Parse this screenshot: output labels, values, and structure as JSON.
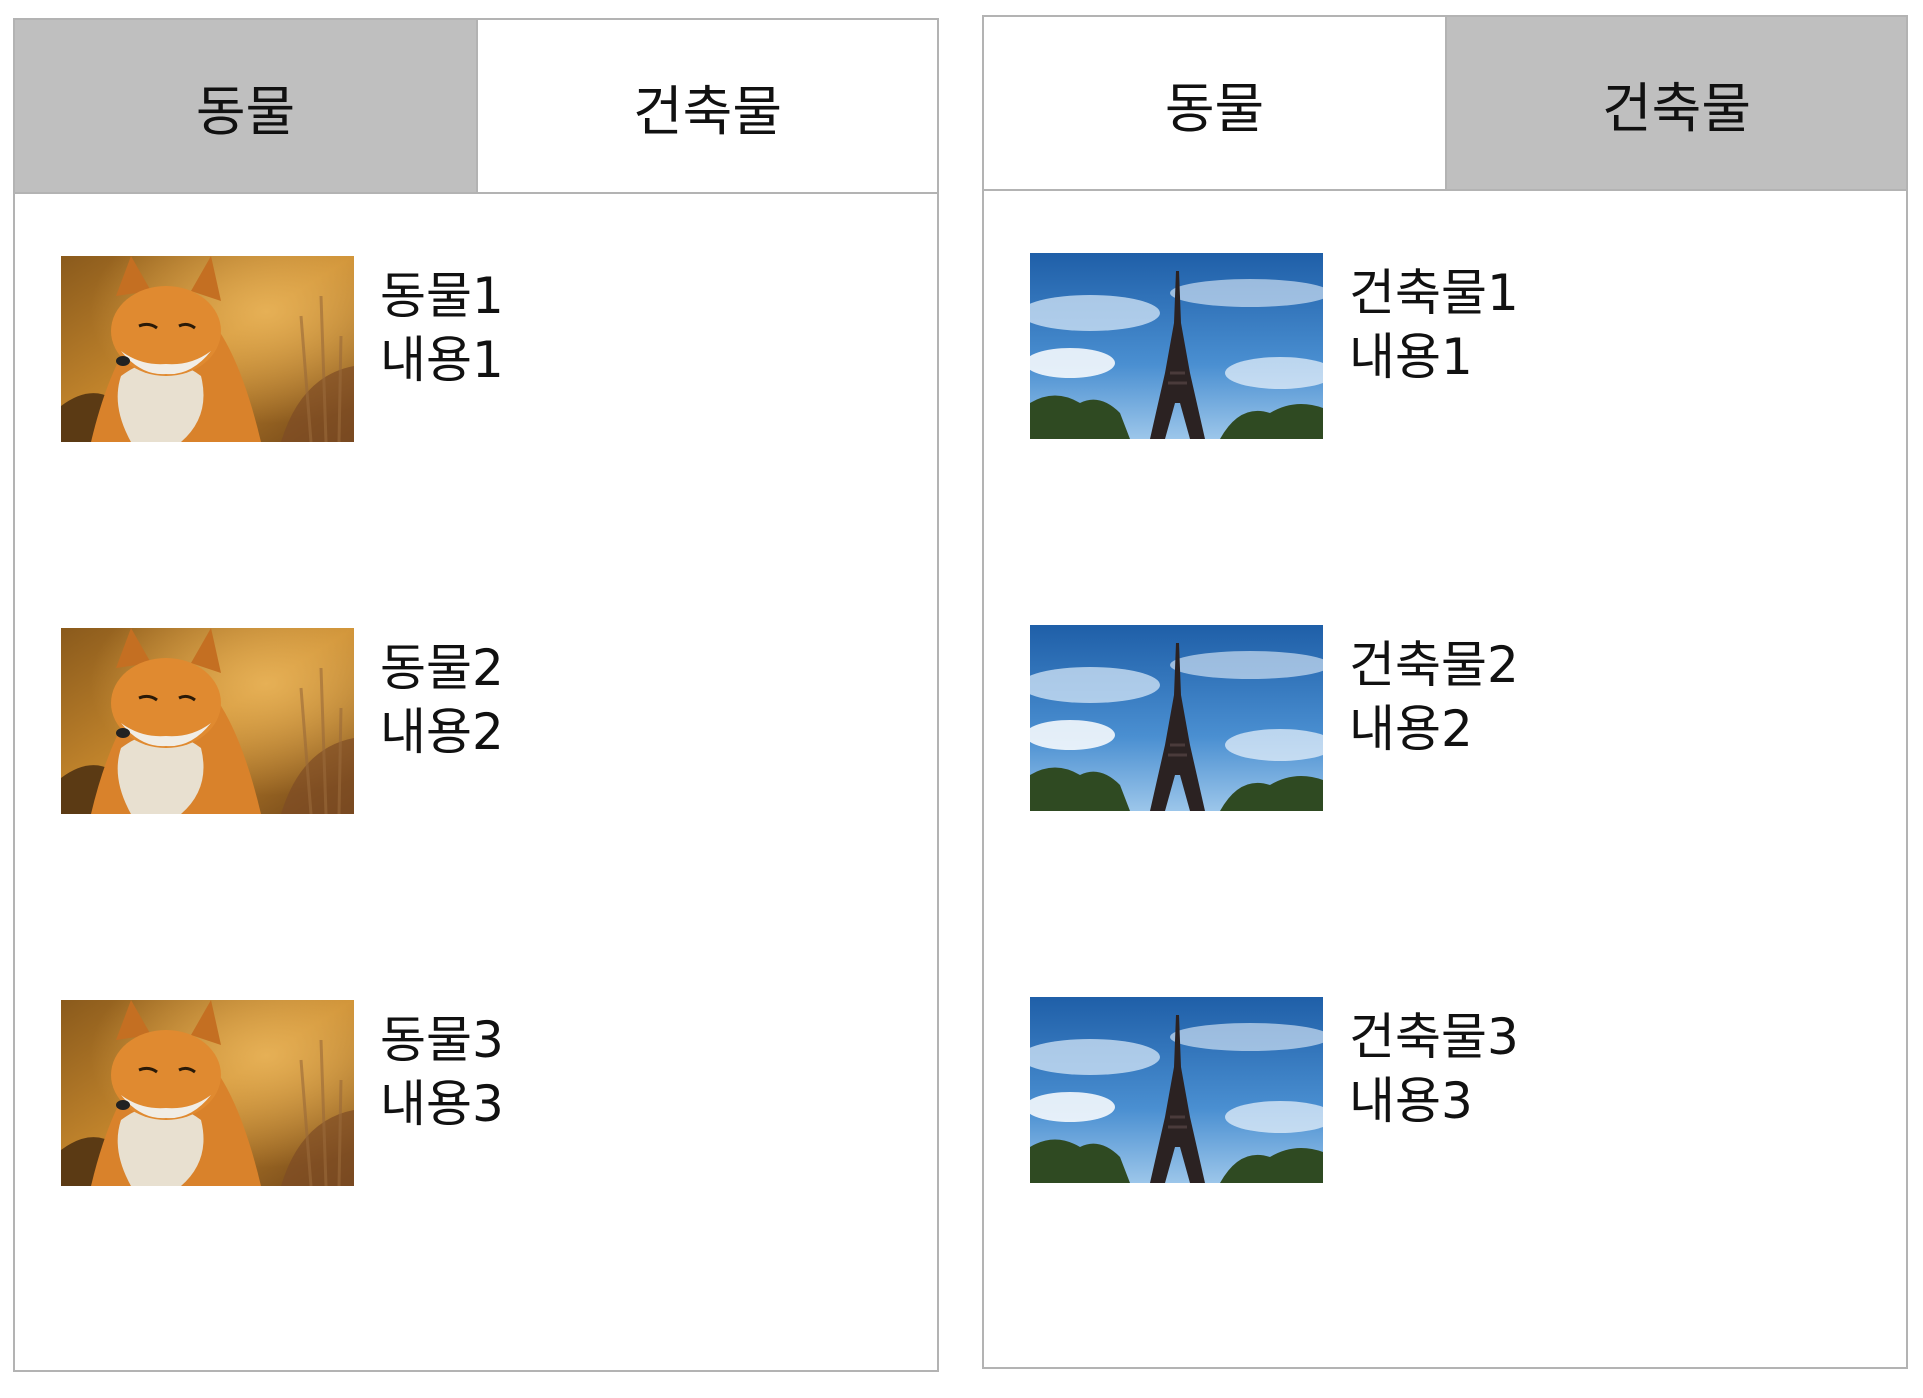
{
  "panels": [
    {
      "tabs": [
        {
          "label": "동물",
          "active": true
        },
        {
          "label": "건축물",
          "active": false
        }
      ],
      "items": [
        {
          "title": "동물1",
          "content": "내용1",
          "image": "fox-photo"
        },
        {
          "title": "동물2",
          "content": "내용2",
          "image": "fox-photo"
        },
        {
          "title": "동물3",
          "content": "내용3",
          "image": "fox-photo"
        }
      ]
    },
    {
      "tabs": [
        {
          "label": "동물",
          "active": false
        },
        {
          "label": "건축물",
          "active": true
        }
      ],
      "items": [
        {
          "title": "건축물1",
          "content": "내용1",
          "image": "eiffel-tower-photo"
        },
        {
          "title": "건축물2",
          "content": "내용2",
          "image": "eiffel-tower-photo"
        },
        {
          "title": "건축물3",
          "content": "내용3",
          "image": "eiffel-tower-photo"
        }
      ]
    }
  ],
  "colors": {
    "active_tab_bg": "#bfbfbf",
    "border": "#b3b3b3"
  }
}
